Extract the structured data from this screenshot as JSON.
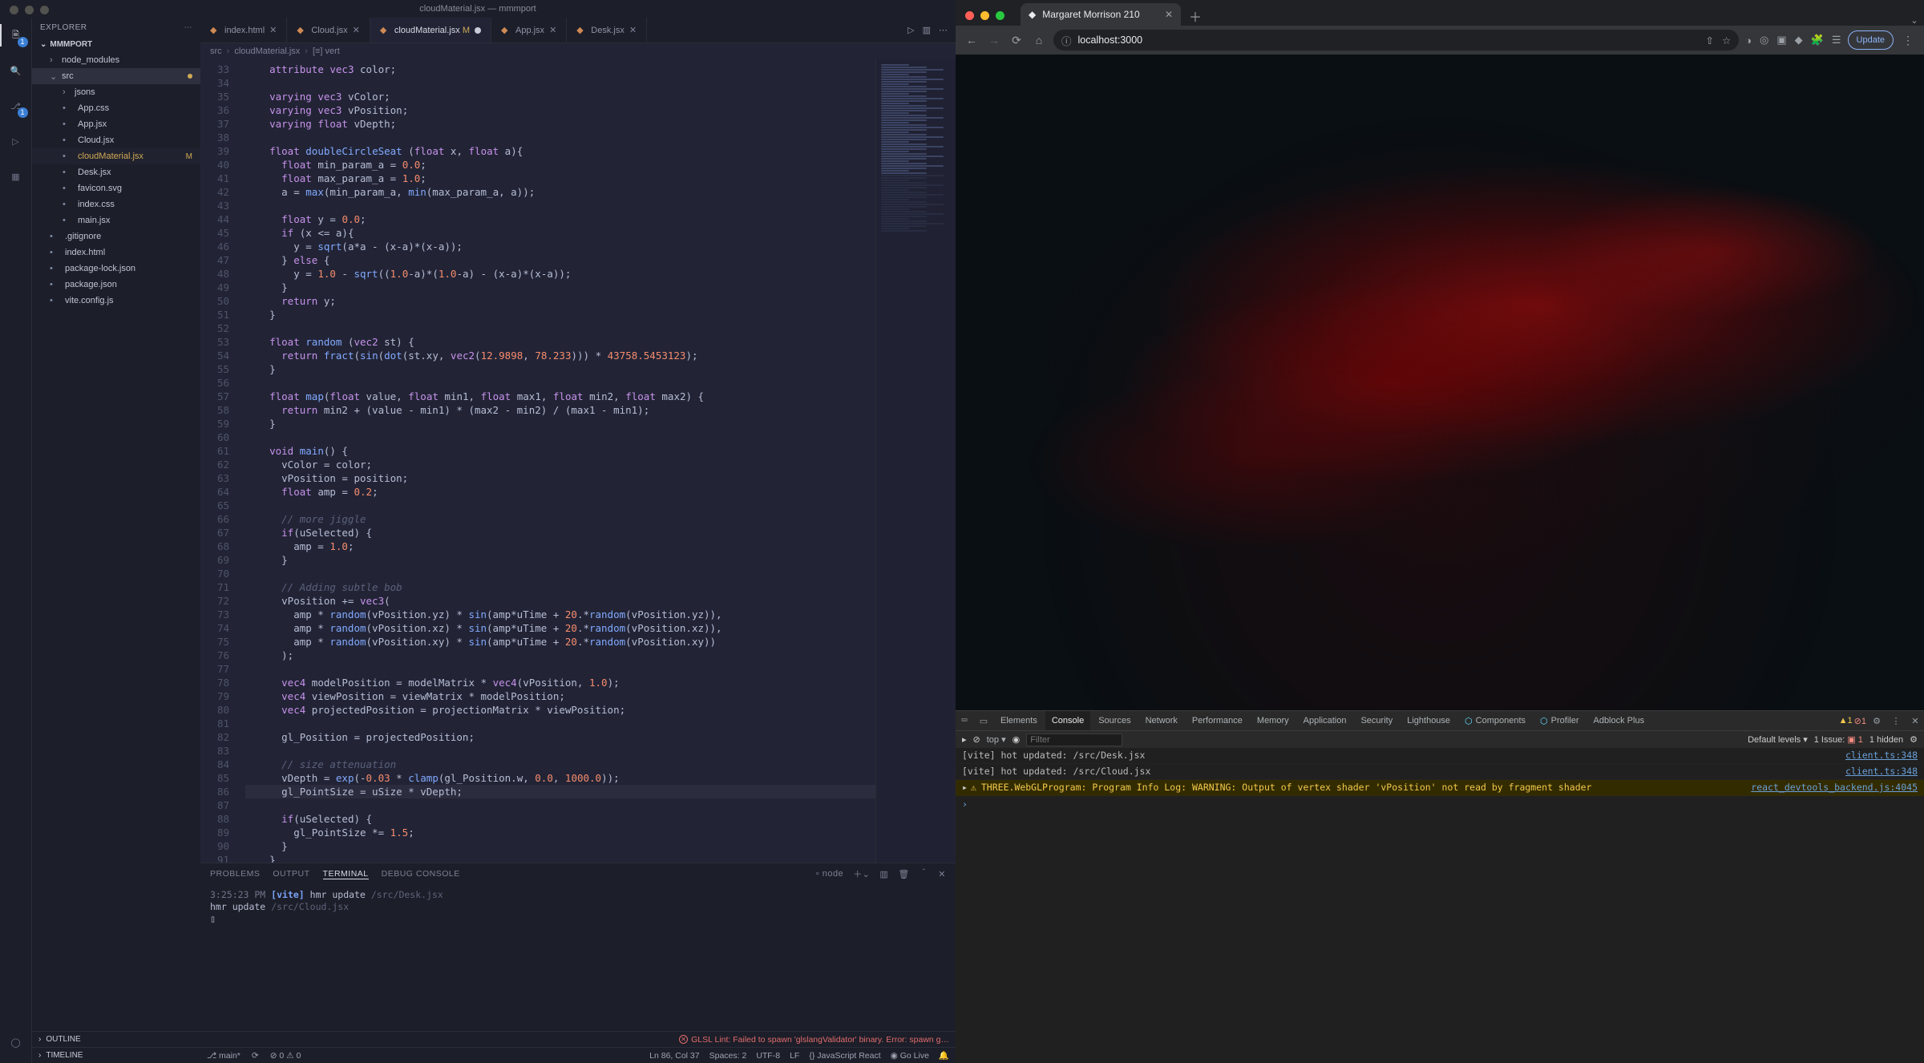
{
  "vscode": {
    "title": "cloudMaterial.jsx — mmmport",
    "explorer_label": "EXPLORER",
    "root": "MMMPORT",
    "tree": [
      {
        "label": "node_modules",
        "kind": "dir",
        "indent": 1,
        "chev": "›"
      },
      {
        "label": "src",
        "kind": "dir",
        "indent": 1,
        "chev": "⌄",
        "hl": true,
        "dot": true
      },
      {
        "label": "jsons",
        "kind": "dir",
        "indent": 2,
        "chev": "›"
      },
      {
        "label": "App.css",
        "kind": "file",
        "indent": 2,
        "icon": "css"
      },
      {
        "label": "App.jsx",
        "kind": "file",
        "indent": 2,
        "icon": "jsx"
      },
      {
        "label": "Cloud.jsx",
        "kind": "file",
        "indent": 2,
        "icon": "jsx"
      },
      {
        "label": "cloudMaterial.jsx",
        "kind": "file",
        "indent": 2,
        "icon": "jsx",
        "sel": true,
        "m": "M"
      },
      {
        "label": "Desk.jsx",
        "kind": "file",
        "indent": 2,
        "icon": "jsx"
      },
      {
        "label": "favicon.svg",
        "kind": "file",
        "indent": 2,
        "icon": "svg"
      },
      {
        "label": "index.css",
        "kind": "file",
        "indent": 2,
        "icon": "css"
      },
      {
        "label": "main.jsx",
        "kind": "file",
        "indent": 2,
        "icon": "jsx"
      },
      {
        "label": ".gitignore",
        "kind": "file",
        "indent": 1,
        "icon": "git"
      },
      {
        "label": "index.html",
        "kind": "file",
        "indent": 1,
        "icon": "html"
      },
      {
        "label": "package-lock.json",
        "kind": "file",
        "indent": 1,
        "icon": "json"
      },
      {
        "label": "package.json",
        "kind": "file",
        "indent": 1,
        "icon": "json"
      },
      {
        "label": "vite.config.js",
        "kind": "file",
        "indent": 1,
        "icon": "js"
      }
    ],
    "tabs": [
      {
        "label": "index.html",
        "icon": "html"
      },
      {
        "label": "Cloud.jsx",
        "icon": "jsx"
      },
      {
        "label": "cloudMaterial.jsx",
        "suffix": "M",
        "icon": "jsx",
        "active": true,
        "dirty": true
      },
      {
        "label": "App.jsx",
        "icon": "jsx"
      },
      {
        "label": "Desk.jsx",
        "icon": "jsx"
      }
    ],
    "crumbs": [
      "src",
      "cloudMaterial.jsx",
      "[≡] vert"
    ],
    "first_line": 33,
    "code": [
      "    attribute vec3 color;",
      "",
      "    varying vec3 vColor;",
      "    varying vec3 vPosition;",
      "    varying float vDepth;",
      "",
      "    float doubleCircleSeat (float x, float a){",
      "      float min_param_a = 0.0;",
      "      float max_param_a = 1.0;",
      "      a = max(min_param_a, min(max_param_a, a));",
      "",
      "      float y = 0.0;",
      "      if (x <= a){",
      "        y = sqrt(a*a - (x-a)*(x-a));",
      "      } else {",
      "        y = 1.0 - sqrt((1.0-a)*(1.0-a) - (x-a)*(x-a));",
      "      }",
      "      return y;",
      "    }",
      "",
      "    float random (vec2 st) {",
      "      return fract(sin(dot(st.xy, vec2(12.9898, 78.233))) * 43758.5453123);",
      "    }",
      "",
      "    float map(float value, float min1, float max1, float min2, float max2) {",
      "      return min2 + (value - min1) * (max2 - min2) / (max1 - min1);",
      "    }",
      "",
      "    void main() {",
      "      vColor = color;",
      "      vPosition = position;",
      "      float amp = 0.2;",
      "",
      "      // more jiggle",
      "      if(uSelected) {",
      "        amp = 1.0;",
      "      }",
      "",
      "      // Adding subtle bob",
      "      vPosition += vec3(",
      "        amp * random(vPosition.yz) * sin(amp*uTime + 20.*random(vPosition.yz)),",
      "        amp * random(vPosition.xz) * sin(amp*uTime + 20.*random(vPosition.xz)),",
      "        amp * random(vPosition.xy) * sin(amp*uTime + 20.*random(vPosition.xy))",
      "      );",
      "",
      "      vec4 modelPosition = modelMatrix * vec4(vPosition, 1.0);",
      "      vec4 viewPosition = viewMatrix * modelPosition;",
      "      vec4 projectedPosition = projectionMatrix * viewPosition;",
      "",
      "      gl_Position = projectedPosition;",
      "",
      "      // size attenuation",
      "      vDepth = exp(-0.03 * clamp(gl_Position.w, 0.0, 1000.0));",
      "      gl_PointSize = uSize * vDepth;",
      "",
      "      if(uSelected) {",
      "        gl_PointSize *= 1.5;",
      "      }",
      "    }",
      "  `,"
    ],
    "highlight_line": 86,
    "panel": {
      "tabs": [
        "PROBLEMS",
        "OUTPUT",
        "TERMINAL",
        "DEBUG CONSOLE"
      ],
      "active": "TERMINAL",
      "shell": "node",
      "lines": [
        {
          "time": "3:25:23 PM",
          "tag": "[vite]",
          "text": "hmr update",
          "dim": "/src/Desk.jsx"
        },
        {
          "time": "",
          "tag": "",
          "text": "hmr update",
          "dim": "/src/Cloud.jsx"
        },
        {
          "time": "",
          "tag": "",
          "text": "▯",
          "dim": ""
        }
      ]
    },
    "status_error": "GLSL Lint: Failed to spawn 'glslangValidator' binary. Error: spawn g…",
    "status": {
      "branch": "main*",
      "sync": "⟳",
      "errors": "0",
      "warnings": "0",
      "pos": "Ln 86, Col 37",
      "spaces": "Spaces: 2",
      "enc": "UTF-8",
      "eol": "LF",
      "lang": "JavaScript React",
      "golive": "Go Live",
      "bell": "🔔"
    },
    "collapsed": [
      "OUTLINE",
      "TIMELINE"
    ],
    "activity_badge_explorer": "1",
    "activity_badge_scm": "1"
  },
  "browser": {
    "tab_title": "Margaret Morrison 210",
    "url": "localhost:3000",
    "update": "Update",
    "devtools_tabs": [
      "Elements",
      "Console",
      "Sources",
      "Network",
      "Performance",
      "Memory",
      "Application",
      "Security",
      "Lighthouse",
      "Components",
      "Profiler",
      "Adblock Plus"
    ],
    "devtools_active": "Console",
    "warn_count": "1",
    "err_count": "1",
    "issue_count": "1 Issue:",
    "issue_err": "1",
    "hidden": "1 hidden",
    "filter_ph": "Filter",
    "levels": "Default levels ▾",
    "top": "top ▾",
    "logs": [
      {
        "kind": "log",
        "msg": "[vite] hot updated: /src/Desk.jsx",
        "src": "client.ts:348"
      },
      {
        "kind": "log",
        "msg": "[vite] hot updated: /src/Cloud.jsx",
        "src": "client.ts:348"
      },
      {
        "kind": "warn",
        "msg": "THREE.WebGLProgram: Program Info Log: WARNING: Output of vertex shader 'vPosition' not read by fragment shader",
        "src": "react_devtools_backend.js:4045"
      }
    ]
  }
}
